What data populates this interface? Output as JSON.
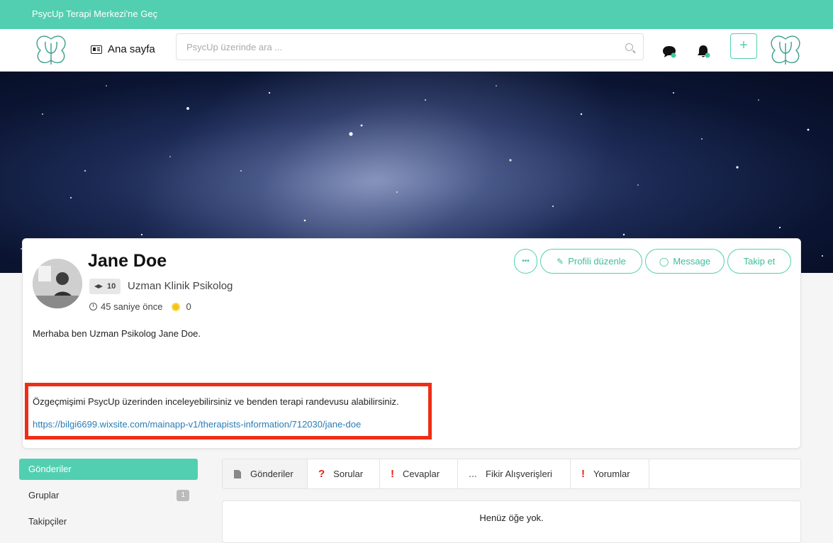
{
  "topbar": {
    "link": "PsycUp Terapi Merkezi'ne Geç"
  },
  "nav": {
    "home_label": "Ana sayfa",
    "search_placeholder": "PsycUp üzerinde ara ...",
    "plus_label": "+"
  },
  "profile": {
    "name": "Jane Doe",
    "level": "10",
    "title": "Uzman Klinik Psikolog",
    "time": "45 saniye önce",
    "points": "0",
    "bio_line1": "Merhaba ben Uzman Psikolog Jane Doe.",
    "bio_line2": "Özgeçmişimi PsycUp üzerinden inceleyebilirsiniz ve benden terapi randevusu alabilirsiniz.",
    "bio_link": "https://bilgi6699.wixsite.com/mainapp-v1/therapists-information/712030/jane-doe"
  },
  "actions": {
    "more": "•••",
    "edit": "Profili düzenle",
    "message": "Message",
    "follow": "Takip et"
  },
  "sidebar": {
    "items": [
      {
        "label": "Gönderiler",
        "count": ""
      },
      {
        "label": "Gruplar",
        "count": "1"
      },
      {
        "label": "Takipçiler",
        "count": ""
      }
    ]
  },
  "tabs": [
    {
      "label": "Gönderiler",
      "icon": "?"
    },
    {
      "label": "Sorular",
      "icon": "?"
    },
    {
      "label": "Cevaplar",
      "icon": "!"
    },
    {
      "label": "Fikir Alışverişleri",
      "icon": "…"
    },
    {
      "label": "Yorumlar",
      "icon": "!"
    }
  ],
  "empty": "Henüz öğe yok.",
  "colors": {
    "accent": "#52cfb1",
    "highlight": "#f02d16",
    "link": "#2a7cb6"
  }
}
